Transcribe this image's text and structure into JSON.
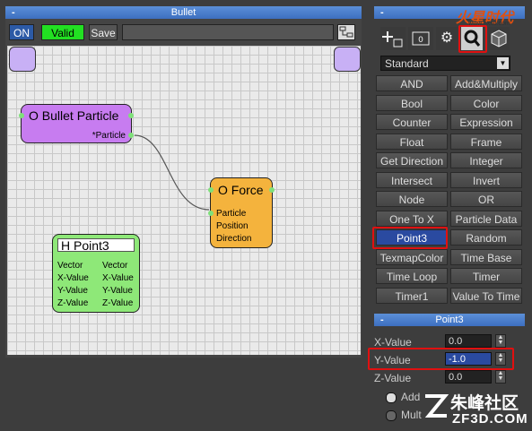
{
  "bullet": {
    "title": "Bullet",
    "toolbar": {
      "on_label": "ON",
      "valid_label": "Valid",
      "save_label": "Save"
    },
    "nodes": {
      "bullet_particle": {
        "title": "O Bullet Particle",
        "output": "*Particle"
      },
      "force": {
        "title": "O Force",
        "inputs": [
          "Particle",
          "Position",
          "Direction"
        ]
      },
      "point3": {
        "title": "H Point3",
        "rows": [
          [
            "Vector",
            "Vector"
          ],
          [
            "X-Value",
            "X-Value"
          ],
          [
            "Y-Value",
            "Y-Value"
          ],
          [
            "Z-Value",
            "Z-Value"
          ]
        ]
      }
    }
  },
  "right": {
    "header_minus": "-",
    "logo_text": "火星时代",
    "logo_url": "www.hxsd.com",
    "dropdown_value": "Standard",
    "buttons": [
      [
        "AND",
        "Add&Multiply"
      ],
      [
        "Bool",
        "Color"
      ],
      [
        "Counter",
        "Expression"
      ],
      [
        "Float",
        "Frame"
      ],
      [
        "Get Direction",
        "Integer"
      ],
      [
        "Intersect",
        "Invert"
      ],
      [
        "Node",
        "OR"
      ],
      [
        "One To X",
        "Particle Data"
      ],
      [
        "Point3",
        "Random"
      ],
      [
        "TexmapColor",
        "Time Base"
      ],
      [
        "Time Loop",
        "Timer"
      ],
      [
        "Timer1",
        "Value To Time"
      ]
    ],
    "point3_panel": {
      "title": "Point3",
      "fields": [
        {
          "label": "X-Value",
          "value": "0.0"
        },
        {
          "label": "Y-Value",
          "value": "-1.0"
        },
        {
          "label": "Z-Value",
          "value": "0.0"
        }
      ],
      "radio_add": "Add",
      "radio_mult": "Mult"
    },
    "watermark_cn": "朱峰社区",
    "watermark_url": "ZF3D.COM"
  },
  "colors": {
    "accent_red": "#e01010",
    "node_purple": "#c77cf0",
    "node_orange": "#f4b33d",
    "node_green": "#8ee878",
    "valid_green": "#22e022"
  }
}
